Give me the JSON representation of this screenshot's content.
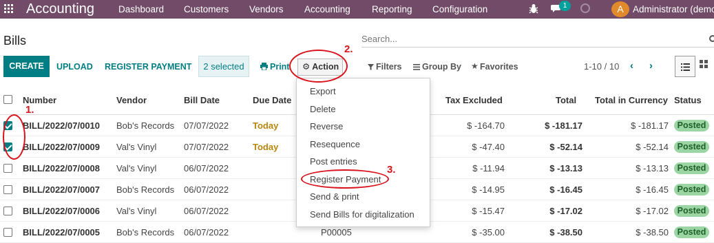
{
  "navbar": {
    "app_name": "Accounting",
    "menu": [
      "Dashboard",
      "Customers",
      "Vendors",
      "Accounting",
      "Reporting",
      "Configuration"
    ],
    "messages_count": "1",
    "avatar_letter": "A",
    "user_name": "Administrator (demo"
  },
  "page": {
    "title": "Bills"
  },
  "search": {
    "placeholder": "Search..."
  },
  "toolbar": {
    "create_label": "CREATE",
    "upload_label": "UPLOAD",
    "register_payment_label": "REGISTER PAYMENT",
    "selected_label": "2 selected",
    "print_label": "Print",
    "action_label": "Action",
    "filters_label": "Filters",
    "groupby_label": "Group By",
    "favorites_label": "Favorites",
    "pager": "1-10 / 10"
  },
  "table": {
    "headers": {
      "number": "Number",
      "vendor": "Vendor",
      "bill_date": "Bill Date",
      "due_date": "Due Date",
      "tax_excluded": "Tax Excluded",
      "total": "Total",
      "total_currency": "Total in Currency",
      "status": "Status"
    },
    "rows": [
      {
        "number": "BILL/2022/07/0010",
        "vendor": "Bob's Records",
        "bill_date": "07/07/2022",
        "due_date": "Today",
        "reference": "",
        "tax_excluded": "$ -164.70",
        "total": "$ -181.17",
        "total_currency": "$ -181.17",
        "status": "Posted",
        "checked": true
      },
      {
        "number": "BILL/2022/07/0009",
        "vendor": "Val's Vinyl",
        "bill_date": "07/07/2022",
        "due_date": "Today",
        "reference": "",
        "tax_excluded": "$ -47.40",
        "total": "$ -52.14",
        "total_currency": "$ -52.14",
        "status": "Posted",
        "checked": true
      },
      {
        "number": "BILL/2022/07/0008",
        "vendor": "Val's Vinyl",
        "bill_date": "06/07/2022",
        "due_date": "",
        "reference": "",
        "tax_excluded": "$ -11.94",
        "total": "$ -13.13",
        "total_currency": "$ -13.13",
        "status": "Posted",
        "checked": false
      },
      {
        "number": "BILL/2022/07/0007",
        "vendor": "Bob's Records",
        "bill_date": "06/07/2022",
        "due_date": "",
        "reference": "",
        "tax_excluded": "$ -14.95",
        "total": "$ -16.45",
        "total_currency": "$ -16.45",
        "status": "Posted",
        "checked": false
      },
      {
        "number": "BILL/2022/07/0006",
        "vendor": "Val's Vinyl",
        "bill_date": "06/07/2022",
        "due_date": "",
        "reference": "",
        "tax_excluded": "$ -15.47",
        "total": "$ -17.02",
        "total_currency": "$ -17.02",
        "status": "Posted",
        "checked": false
      },
      {
        "number": "BILL/2022/07/0005",
        "vendor": "Bob's Records",
        "bill_date": "06/07/2022",
        "due_date": "",
        "reference": "P00005",
        "tax_excluded": "$ -35.00",
        "total": "$ -38.50",
        "total_currency": "$ -38.50",
        "status": "Posted",
        "checked": false
      }
    ]
  },
  "action_menu": {
    "items": [
      "Export",
      "Delete",
      "Reverse",
      "Resequence",
      "Post entries",
      "Register Payment",
      "Send & print",
      "Send Bills for digitalization"
    ]
  },
  "annotations": {
    "step1": "1.",
    "step2": "2.",
    "step3": "3.",
    "color": "#d8131b"
  }
}
